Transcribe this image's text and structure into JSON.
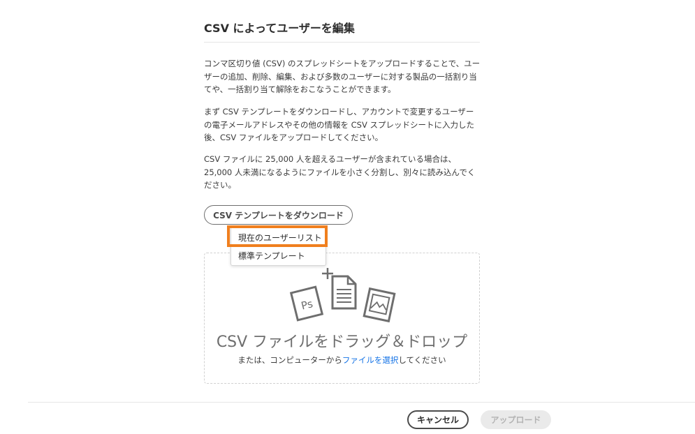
{
  "dialog": {
    "title": "CSV によってユーザーを編集",
    "paragraphs": [
      "コンマ区切り値 (CSV) のスプレッドシートをアップロードすることで、ユーザーの追加、削除、編集、および多数のユーザーに対する製品の一括割り当てや、一括割り当て解除をおこなうことができます。",
      "まず CSV テンプレートをダウンロードし、アカウントで変更するユーザーの電子メールアドレスやその他の情報を CSV スプレッドシートに入力した後、CSV ファイルをアップロードしてください。",
      "CSV ファイルに 25,000 人を超えるユーザーが含まれている場合は、25,000 人未満になるようにファイルを小さく分割し、別々に読み込んでください。"
    ],
    "download_button": "CSV テンプレートをダウンロード",
    "dropdown": {
      "items": [
        "現在のユーザーリスト",
        "標準テンプレート"
      ],
      "highlighted_index": 0,
      "highlight_color": "#f07f1e"
    },
    "drop_zone": {
      "title": "CSV ファイルをドラッグ＆ドロップ",
      "subtitle_prefix": "または、コンピューターから",
      "subtitle_link": "ファイルを選択",
      "subtitle_suffix": "してください",
      "icons": [
        "photoshop-file-icon",
        "add-document-icon",
        "image-file-icon"
      ],
      "icon_text_ps": "Ps"
    },
    "footer": {
      "cancel_label": "キャンセル",
      "upload_label": "アップロード",
      "upload_disabled": true
    }
  },
  "colors": {
    "link": "#1473e6",
    "text": "#2c2c2c",
    "highlight": "#f07f1e",
    "disabled_bg": "#eaeaea",
    "disabled_text": "#b3b3b3"
  }
}
